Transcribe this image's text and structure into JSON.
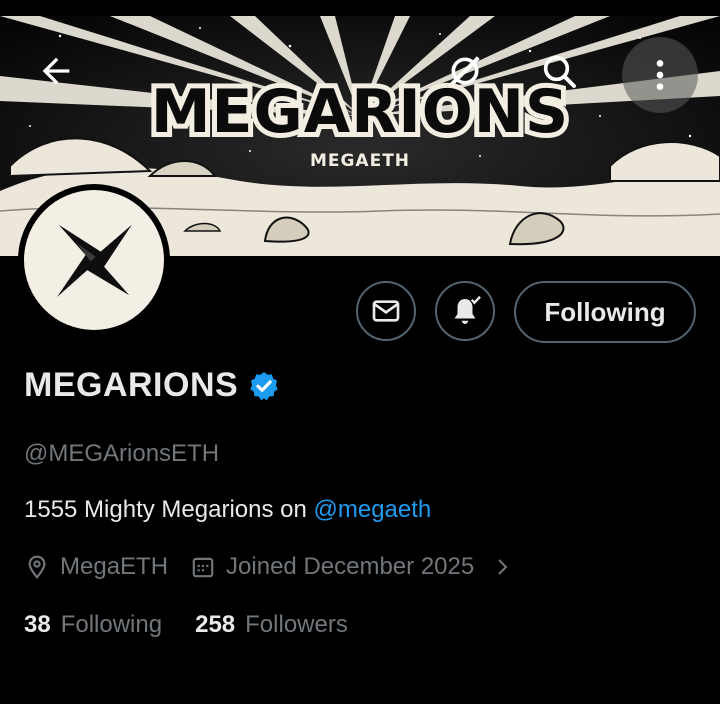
{
  "header": {
    "banner_title": "MEGARIONS",
    "banner_subtitle": "MEGAETH",
    "back_icon": "arrow-left-icon",
    "grok_icon": "grok-icon",
    "search_icon": "search-icon",
    "more_icon": "more-vertical-icon"
  },
  "profile": {
    "display_name": "MEGARIONS",
    "verified": true,
    "handle": "@MEGArionsETH",
    "bio_text": "1555 Mighty Megarions on ",
    "bio_mention": "@megaeth",
    "location": "MegaETH",
    "joined": "Joined December 2025",
    "following_count": "38",
    "following_label": "Following",
    "followers_count": "258",
    "followers_label": "Followers"
  },
  "actions": {
    "message_icon": "envelope-icon",
    "notify_icon": "bell-check-icon",
    "follow_button_label": "Following"
  },
  "colors": {
    "background": "#000000",
    "accent": "#1d9bf0",
    "muted": "#71767b",
    "border": "#536471"
  }
}
